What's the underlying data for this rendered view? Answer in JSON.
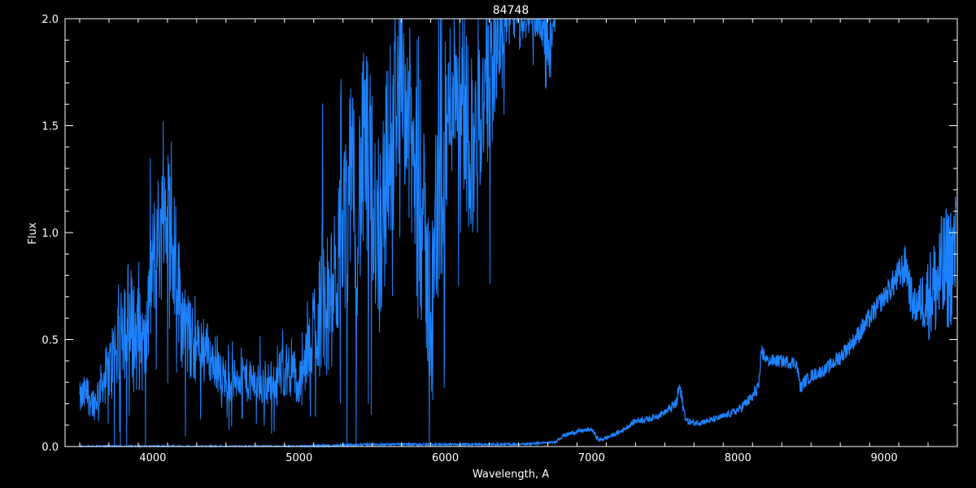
{
  "chart_data": {
    "type": "line",
    "title": "84748",
    "xlabel": "Wavelength, A",
    "ylabel": "Flux",
    "xlim": [
      3400,
      9500
    ],
    "ylim": [
      0.0,
      2.0
    ],
    "x_ticks": [
      4000,
      5000,
      6000,
      7000,
      8000,
      9000
    ],
    "x_tick_labels": [
      "4000",
      "5000",
      "6000",
      "7000",
      "8000",
      "9000"
    ],
    "y_ticks": [
      0.0,
      0.5,
      1.0,
      1.5,
      2.0
    ],
    "y_tick_labels": [
      "0.0",
      "0.5",
      "1.0",
      "1.5",
      "2.0"
    ],
    "grid": false,
    "background": "#000000",
    "line_color": "#1e82ff",
    "axis_color": "#ffffff",
    "series": [
      {
        "style": "noisy-spectrum",
        "x": [
          3500,
          3550,
          3600,
          3650,
          3700,
          3750,
          3800,
          3850,
          3900,
          3950,
          4000,
          4050,
          4100,
          4150,
          4200,
          4250,
          4300,
          4350,
          4400,
          4450,
          4500,
          4550,
          4600,
          4650,
          4700,
          4750,
          4800,
          4850,
          4900,
          4950,
          5000,
          5050,
          5100,
          5150,
          5200,
          5250,
          5300,
          5350,
          5400,
          5450,
          5500,
          5550,
          5600,
          5650,
          5700,
          5750,
          5800,
          5850,
          5900,
          5950,
          6000,
          6050,
          6100,
          6150,
          6200,
          6250,
          6300,
          6350,
          6400,
          6450,
          6500,
          6550,
          6600,
          6650,
          6700,
          6750
        ],
        "y": [
          0.22,
          0.25,
          0.2,
          0.3,
          0.35,
          0.45,
          0.62,
          0.55,
          0.5,
          0.45,
          0.85,
          1.0,
          1.1,
          0.9,
          0.6,
          0.5,
          0.45,
          0.5,
          0.4,
          0.35,
          0.32,
          0.3,
          0.35,
          0.3,
          0.3,
          0.28,
          0.3,
          0.32,
          0.35,
          0.38,
          0.25,
          0.4,
          0.55,
          0.7,
          0.6,
          0.8,
          1.0,
          1.2,
          1.1,
          1.4,
          1.2,
          1.0,
          1.3,
          1.6,
          1.8,
          1.5,
          1.2,
          1.0,
          0.6,
          1.1,
          1.4,
          1.7,
          1.8,
          1.5,
          1.4,
          1.6,
          1.7,
          1.9,
          2.0,
          2.0,
          2.0,
          2.0,
          2.0,
          2.0,
          1.8,
          2.0
        ],
        "noise": [
          0.08,
          0.1,
          0.08,
          0.1,
          0.15,
          0.25,
          0.3,
          0.3,
          0.25,
          0.2,
          0.3,
          0.35,
          0.35,
          0.3,
          0.25,
          0.2,
          0.15,
          0.15,
          0.12,
          0.1,
          0.1,
          0.1,
          0.12,
          0.1,
          0.1,
          0.1,
          0.1,
          0.12,
          0.12,
          0.15,
          0.1,
          0.15,
          0.25,
          0.4,
          0.3,
          0.35,
          0.4,
          0.5,
          0.5,
          0.5,
          0.5,
          0.5,
          0.5,
          0.45,
          0.4,
          0.5,
          0.5,
          0.5,
          0.4,
          0.5,
          0.5,
          0.4,
          0.45,
          0.5,
          0.4,
          0.4,
          0.4,
          0.3,
          0.2,
          0.1,
          0.1,
          0.1,
          0.1,
          0.1,
          0.2,
          0.1
        ]
      },
      {
        "style": "smooth-continuum",
        "x": [
          3500,
          4000,
          4500,
          5000,
          5500,
          6000,
          6500,
          6750,
          6800,
          6900,
          7000,
          7050,
          7100,
          7200,
          7300,
          7400,
          7500,
          7580,
          7600,
          7630,
          7650,
          7700,
          7800,
          7900,
          8000,
          8100,
          8150,
          8160,
          8200,
          8300,
          8400,
          8430,
          8450,
          8500,
          8600,
          8700,
          8800,
          8850,
          8900,
          9000,
          9100,
          9150,
          9180,
          9200,
          9250,
          9300,
          9350,
          9400,
          9450,
          9490
        ],
        "y": [
          0.0,
          0.0,
          0.0,
          0.0,
          0.01,
          0.01,
          0.01,
          0.02,
          0.05,
          0.07,
          0.08,
          0.03,
          0.04,
          0.07,
          0.12,
          0.13,
          0.16,
          0.2,
          0.28,
          0.17,
          0.12,
          0.11,
          0.12,
          0.14,
          0.17,
          0.23,
          0.3,
          0.45,
          0.4,
          0.4,
          0.39,
          0.27,
          0.3,
          0.33,
          0.36,
          0.42,
          0.5,
          0.55,
          0.6,
          0.7,
          0.8,
          0.85,
          0.72,
          0.65,
          0.68,
          0.7,
          0.75,
          0.8,
          0.85,
          0.9
        ],
        "noise": [
          0.005,
          0.005,
          0.005,
          0.005,
          0.005,
          0.005,
          0.005,
          0.005,
          0.01,
          0.01,
          0.01,
          0.01,
          0.01,
          0.01,
          0.015,
          0.015,
          0.015,
          0.03,
          0.06,
          0.02,
          0.015,
          0.015,
          0.015,
          0.015,
          0.02,
          0.03,
          0.04,
          0.04,
          0.03,
          0.03,
          0.03,
          0.03,
          0.03,
          0.03,
          0.03,
          0.04,
          0.04,
          0.05,
          0.05,
          0.05,
          0.08,
          0.1,
          0.1,
          0.08,
          0.12,
          0.2,
          0.25,
          0.3,
          0.3,
          0.3
        ]
      }
    ]
  }
}
